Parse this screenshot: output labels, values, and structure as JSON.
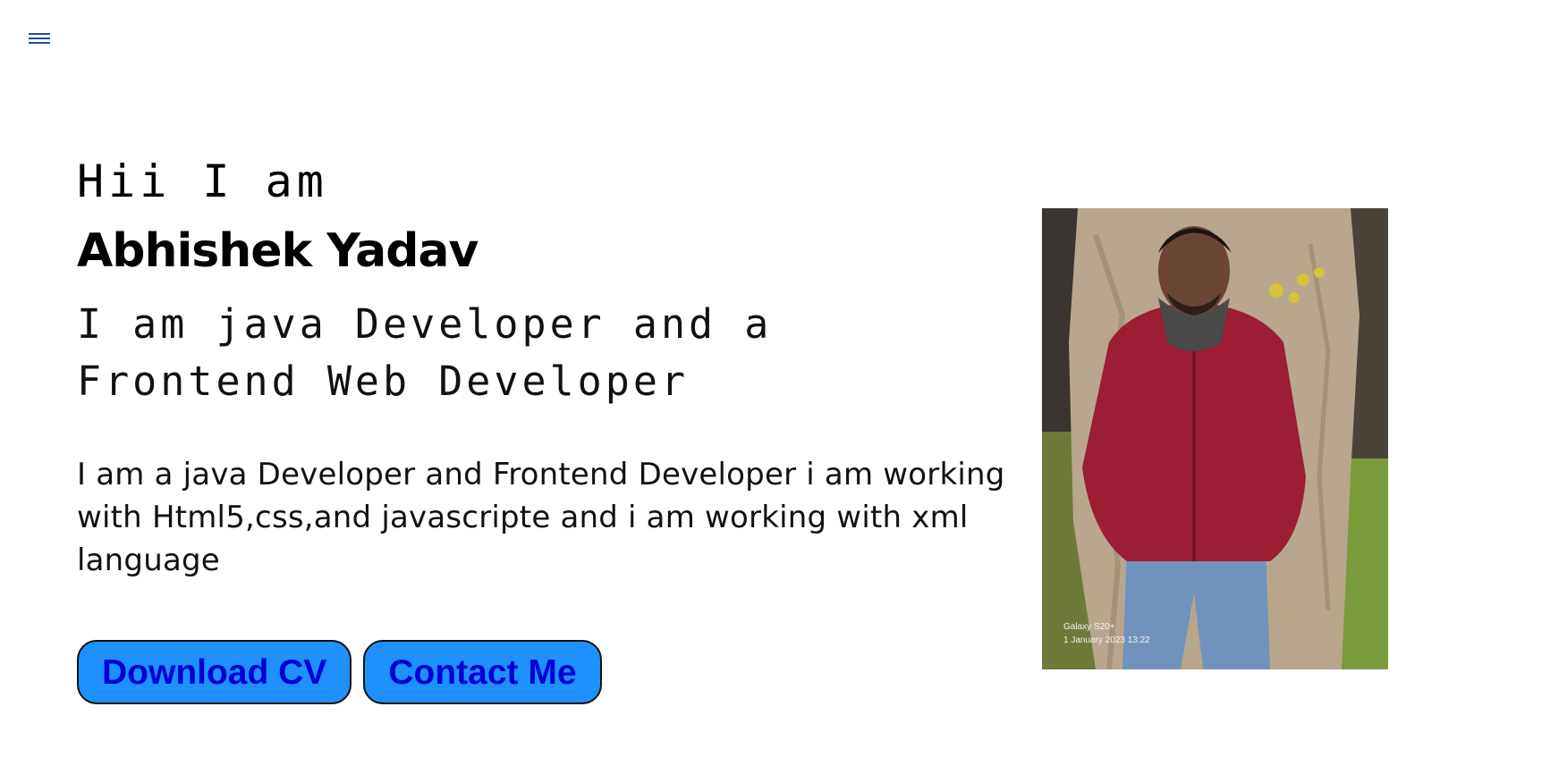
{
  "header": {
    "menu_icon": "hamburger-menu-icon"
  },
  "hero": {
    "greeting": "Hii I am",
    "name": "Abhishek Yadav",
    "role": "I am java Developer and a Frontend Web Developer",
    "description": "I am a java Developer and Frontend Developer i am working with Html5,css,and javascripte and i am working with xml language"
  },
  "buttons": {
    "download_cv": "Download CV",
    "contact_me": "Contact Me"
  },
  "photo": {
    "caption_line1": "Galaxy S20+",
    "caption_line2": "1 January 2023 13:22"
  },
  "colors": {
    "button_bg": "#1e90ff",
    "button_text": "#0000d6",
    "menu_icon": "#1f4e96"
  }
}
